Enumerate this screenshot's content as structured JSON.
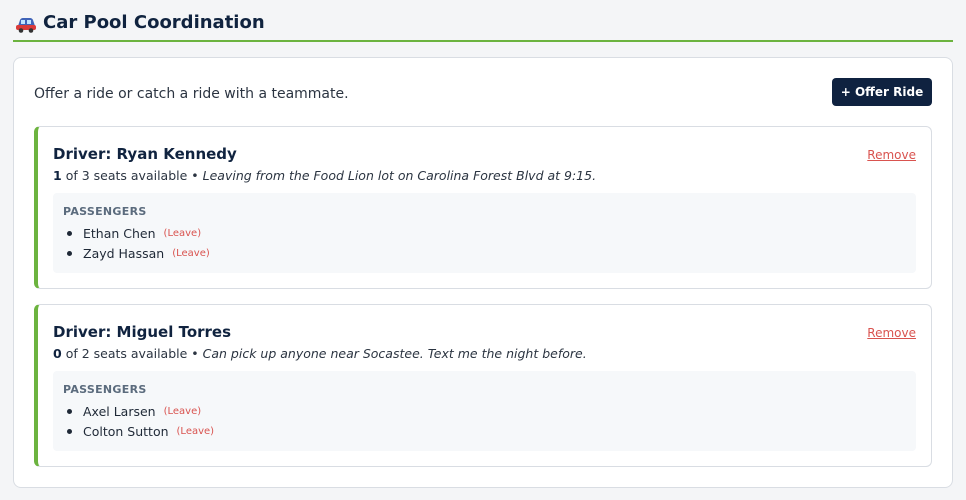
{
  "header": {
    "title": "Car Pool Coordination",
    "icon": "car-icon"
  },
  "intro": "Offer a ride or catch a ride with a teammate.",
  "offer_button": "+ Offer Ride",
  "colors": {
    "accent": "#6cb33f",
    "navy": "#0f2240",
    "danger": "#d9534f"
  },
  "rides": [
    {
      "driver": "Driver: Ryan Kennedy",
      "remove": "Remove",
      "seats_available": "1",
      "seats_text": "of 3 seats available •",
      "note": "Leaving from the Food Lion lot on Carolina Forest Blvd at 9:15.",
      "passengers_title": "PASSENGERS",
      "passengers": [
        {
          "name": "Ethan Chen",
          "leave": "(Leave)"
        },
        {
          "name": "Zayd Hassan",
          "leave": "(Leave)"
        }
      ]
    },
    {
      "driver": "Driver: Miguel Torres",
      "remove": "Remove",
      "seats_available": "0",
      "seats_text": "of 2 seats available •",
      "note": "Can pick up anyone near Socastee. Text me the night before.",
      "passengers_title": "PASSENGERS",
      "passengers": [
        {
          "name": "Axel Larsen",
          "leave": "(Leave)"
        },
        {
          "name": "Colton Sutton",
          "leave": "(Leave)"
        }
      ]
    }
  ]
}
